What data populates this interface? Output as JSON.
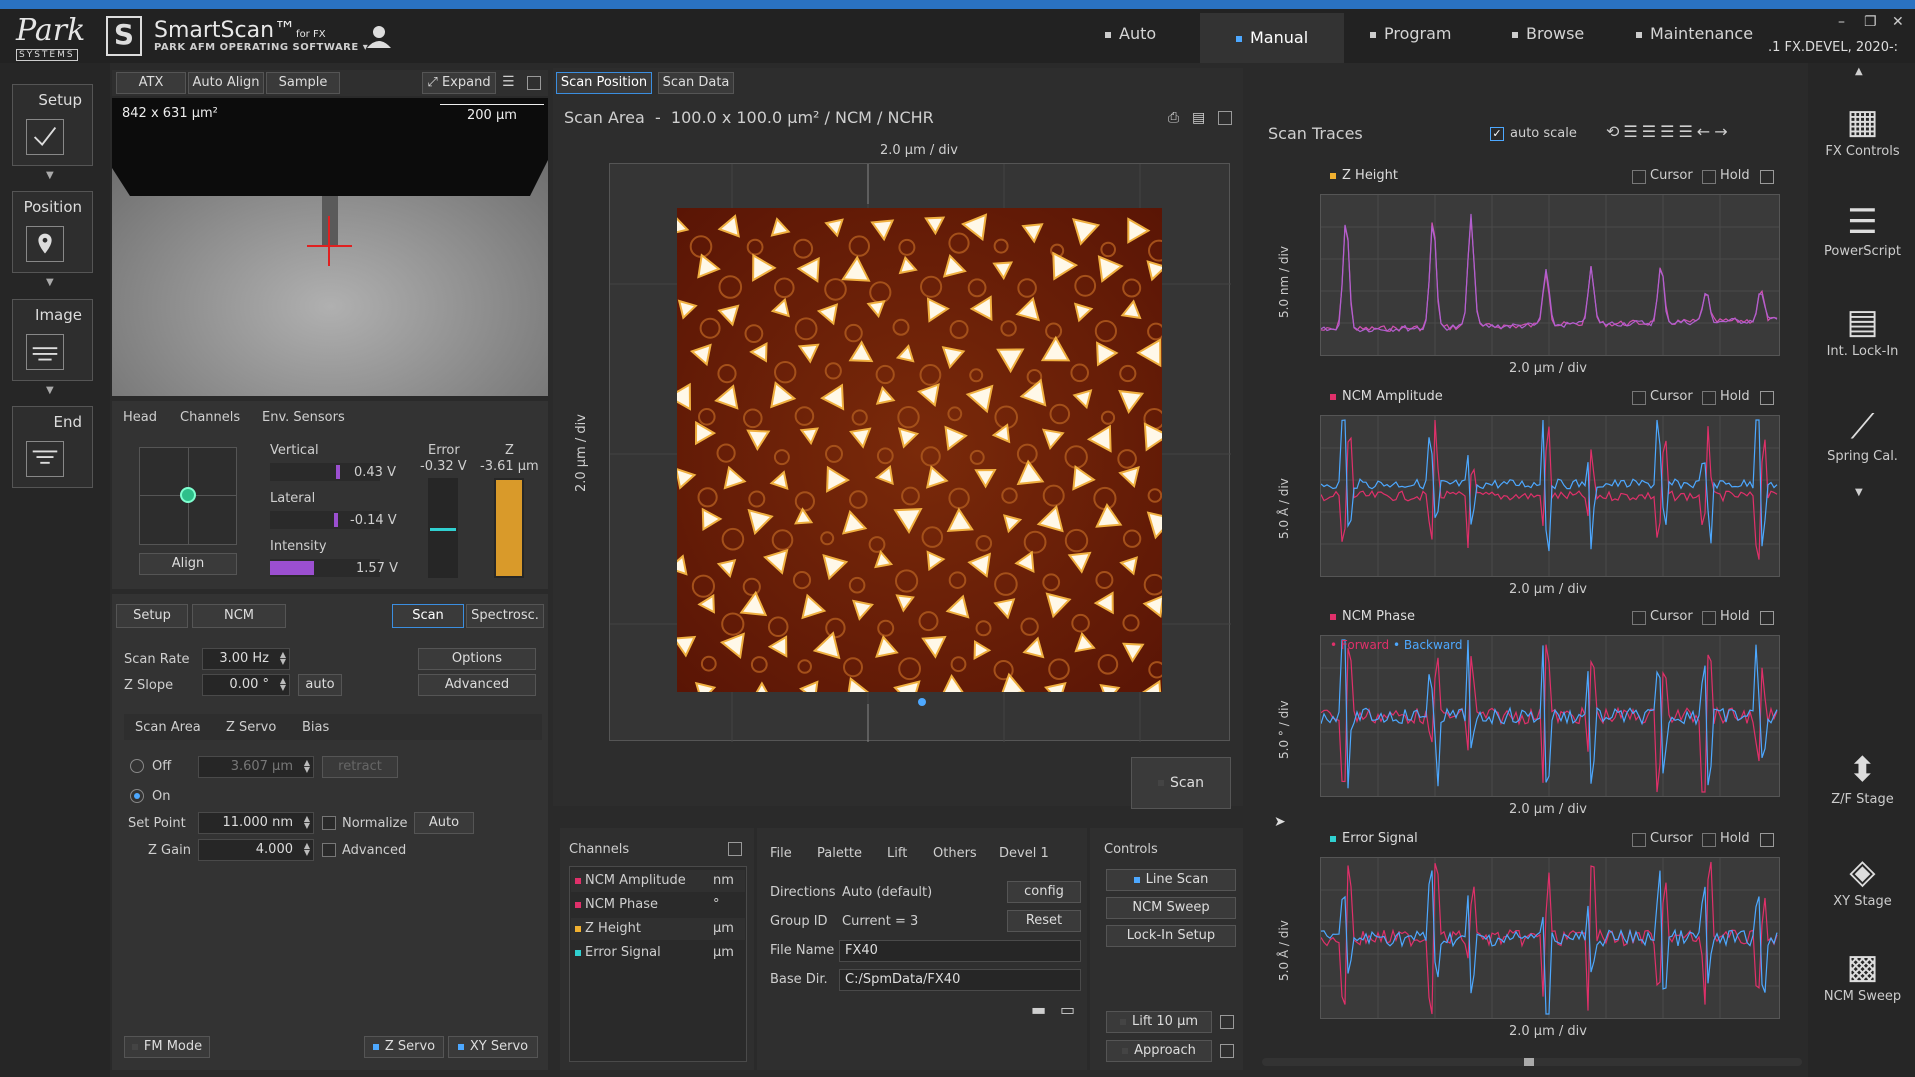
{
  "header": {
    "logo_text": "Park",
    "logo_sub": "SYSTEMS",
    "brand_mark": "S",
    "brand_title": "SmartScan™",
    "brand_title_suffix": "for FX",
    "brand_subtitle": "PARK AFM OPERATING SOFTWARE",
    "modes": [
      "Auto",
      "Manual",
      "Program",
      "Browse",
      "Maintenance"
    ],
    "active_mode": "Manual",
    "version": ".1 FX.DEVEL, 2020-:"
  },
  "steps": [
    "Setup",
    "Position",
    "Image",
    "End"
  ],
  "camera": {
    "tabs": [
      "ATX",
      "Auto Align",
      "Sample"
    ],
    "expand_label": "Expand",
    "size_label": "842 x 631 µm²",
    "scale_label": "200 µm"
  },
  "head": {
    "tabs": [
      "Head",
      "Channels",
      "Env. Sensors"
    ],
    "vertical_label": "Vertical",
    "vertical_value": "0.43 V",
    "lateral_label": "Lateral",
    "lateral_value": "-0.14 V",
    "intensity_label": "Intensity",
    "intensity_value": "1.57 V",
    "error_label": "Error",
    "error_value": "-0.32 V",
    "z_label": "Z",
    "z_value": "-3.61 µm",
    "align_label": "Align"
  },
  "scan_params": {
    "tabs": [
      "Setup",
      "NCM",
      "Scan",
      "Spectrosc."
    ],
    "scan_rate_label": "Scan Rate",
    "scan_rate": "3.00 Hz",
    "z_slope_label": "Z Slope",
    "z_slope": "0.00 °",
    "auto_label": "auto",
    "options_label": "Options",
    "advanced_label": "Advanced",
    "subtabs": [
      "Scan Area",
      "Z Servo",
      "Bias"
    ],
    "off_label": "Off",
    "off_value": "3.607 µm",
    "retract_label": "retract",
    "on_label": "On",
    "set_point_label": "Set Point",
    "set_point": "11.000 nm",
    "normalize_label": "Normalize",
    "auto_btn": "Auto",
    "z_gain_label": "Z Gain",
    "z_gain": "4.000",
    "advanced2_label": "Advanced",
    "footer": [
      "FM Mode",
      "Z Servo",
      "XY Servo"
    ]
  },
  "scan_area": {
    "tabs": [
      "Scan Position",
      "Scan Data"
    ],
    "title": "Scan Area  -  100.0 x 100.0 µm² / NCM / NCHR",
    "x_div": "2.0 µm / div",
    "y_div": "2.0 µm / div",
    "scan_button": "Scan"
  },
  "channels": {
    "title": "Channels",
    "items": [
      {
        "name": "NCM Amplitude",
        "unit": "nm",
        "color": "#e0306a"
      },
      {
        "name": "NCM Phase",
        "unit": "°",
        "color": "#e0306a"
      },
      {
        "name": "Z Height",
        "unit": "µm",
        "color": "#f0b030"
      },
      {
        "name": "Error Signal",
        "unit": "µm",
        "color": "#30d0d0"
      }
    ]
  },
  "file": {
    "tabs": [
      "File",
      "Palette",
      "Lift",
      "Others",
      "Devel 1"
    ],
    "directions_label": "Directions",
    "directions": "Auto (default)",
    "config_label": "config",
    "group_label": "Group ID",
    "group": "Current = 3",
    "reset_label": "Reset",
    "filename_label": "File Name",
    "filename": "FX40",
    "basedir_label": "Base Dir.",
    "basedir": "C:/SpmData/FX40"
  },
  "controls": {
    "title": "Controls",
    "buttons": [
      "Line Scan",
      "NCM Sweep",
      "Lock-In Setup"
    ],
    "lift_label": "Lift 10 µm",
    "approach_label": "Approach"
  },
  "traces": {
    "title": "Scan Traces",
    "auto_scale_label": "auto scale",
    "cursor_label": "Cursor",
    "hold_label": "Hold",
    "legend_forward": "• Forward",
    "legend_backward": "• Backward",
    "items": [
      {
        "name": "Z Height",
        "color": "#f0b030",
        "ylab": "5.0 nm / div",
        "xlab": "2.0 µm / div"
      },
      {
        "name": "NCM Amplitude",
        "color": "#e0306a",
        "ylab": "5.0 Å / div",
        "xlab": "2.0 µm / div"
      },
      {
        "name": "NCM Phase",
        "color": "#e0306a",
        "ylab": "5.0 ° / div",
        "xlab": "2.0 µm / div"
      },
      {
        "name": "Error Signal",
        "color": "#30d0d0",
        "ylab": "5.0 Å / div",
        "xlab": "2.0 µm / div"
      }
    ]
  },
  "tools": [
    "FX Controls",
    "PowerScript",
    "Int. Lock-In",
    "Spring Cal.",
    "Z/F Stage",
    "XY Stage",
    "NCM Sweep"
  ]
}
